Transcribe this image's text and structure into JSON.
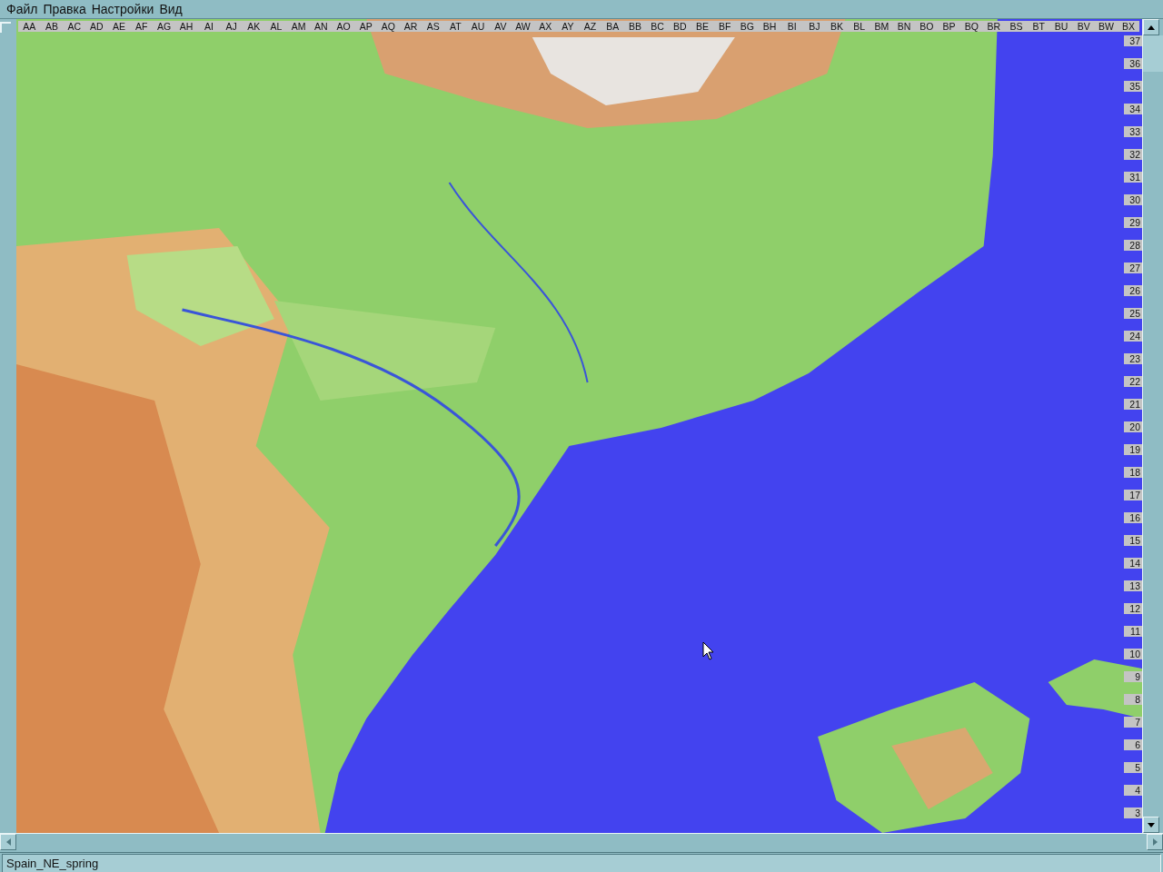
{
  "menu": [
    "Файл",
    "Правка",
    "Настройки",
    "Вид"
  ],
  "map": {
    "kind": "picture",
    "column_labels": [
      "AA",
      "AB",
      "AC",
      "AD",
      "AE",
      "AF",
      "AG",
      "AH",
      "AI",
      "AJ",
      "AK",
      "AL",
      "AM",
      "AN",
      "AO",
      "AP",
      "AQ",
      "AR",
      "AS",
      "AT",
      "AU",
      "AV",
      "AW",
      "AX",
      "AY",
      "AZ",
      "BA",
      "BB",
      "BC",
      "BD",
      "BE",
      "BF",
      "BG",
      "BH",
      "BI",
      "BJ",
      "BK",
      "BL",
      "BM",
      "BN",
      "BO",
      "BP",
      "BQ",
      "BR",
      "BS",
      "BT",
      "BU",
      "BV",
      "BW",
      "BX"
    ],
    "row_labels": [
      "37",
      "36",
      "35",
      "34",
      "33",
      "32",
      "31",
      "30",
      "29",
      "28",
      "27",
      "26",
      "25",
      "24",
      "23",
      "22",
      "21",
      "20",
      "19",
      "18",
      "17",
      "16",
      "15",
      "14",
      "13",
      "12",
      "11",
      "10",
      "9",
      "8",
      "7",
      "6",
      "5",
      "4",
      "3"
    ]
  },
  "status_bar": "Spain_NE_spring"
}
